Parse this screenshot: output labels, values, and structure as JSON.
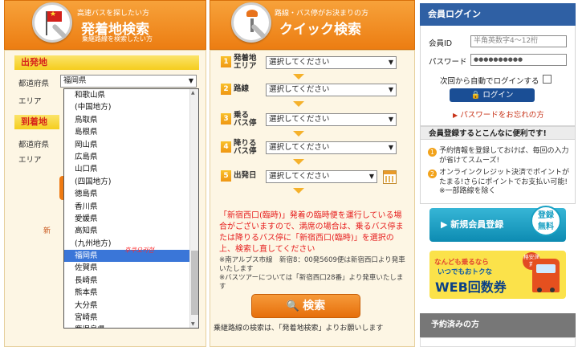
{
  "departure_panel": {
    "header_small": "高速バスを探したい方",
    "header_title": "発着地検索",
    "header_sub": "乗継路線を検索したい方",
    "departure_section": "出発地",
    "arrival_section": "到着地",
    "prefecture_label": "都道府県",
    "area_label": "エリア",
    "prefecture_selected": "福岡県",
    "prefecture_options": [
      "和歌山県",
      "(中国地方)",
      "鳥取県",
      "島根県",
      "岡山県",
      "広島県",
      "山口県",
      "(四国地方)",
      "徳島県",
      "香川県",
      "愛媛県",
      "高知県",
      "(九州地方)",
      "福岡県",
      "佐賀県",
      "長崎県",
      "熊本県",
      "大分県",
      "宮崎県",
      "鹿児島県"
    ],
    "selected_index": 13,
    "annotation_text": "후쿠오카현",
    "link_fragment": "新"
  },
  "quick_panel": {
    "header_small": "路線・バス停がお決まりの方",
    "header_title": "クイック検索",
    "steps": [
      {
        "num": "1",
        "label_line1": "発着地",
        "label_line2": "エリア",
        "select": "選択してください"
      },
      {
        "num": "2",
        "label_line1": "路線",
        "label_line2": "",
        "select": "選択してください"
      },
      {
        "num": "3",
        "label_line1": "乗る",
        "label_line2": "バス停",
        "select": "選択してください"
      },
      {
        "num": "4",
        "label_line1": "降りる",
        "label_line2": "バス停",
        "select": "選択してください"
      },
      {
        "num": "5",
        "label_line1": "出発日",
        "label_line2": "",
        "select": "選択してください"
      }
    ],
    "notice": "「新宿西口(臨時)」発着の臨時便を運行している場合がございますので、満席の場合は、乗るバス停または降りるバス停に「新宿西口(臨時)」を選択の上、検索し直してください",
    "note1": "※南アルプス市線　新宿8：00発5609便は新宿西口より発車いたします",
    "note2": "※バスツアーについては「新宿西口28番」より発車いたします",
    "search_button": "検索",
    "bottom_note": "乗継路線の検索は、「発着地検索」よりお願いします"
  },
  "login_panel": {
    "header": "会員ログイン",
    "id_label": "会員ID",
    "id_placeholder": "半角英数字4〜12桁",
    "password_label": "パスワード",
    "password_value": "●●●●●●●●●●",
    "remember_label": "次回から自動でログインする",
    "login_button": "ログイン",
    "forgot_link": "パスワードをお忘れの方"
  },
  "benefits": {
    "header": "会員登録するとこんなに便利です!",
    "items": [
      {
        "num": "1",
        "text": "予約情報を登録しておけば、毎回の入力が省けてスムーズ!"
      },
      {
        "num": "2",
        "text": "オンラインクレジット決済でポイントがたまる!さらにポイントでお支払い可能! ※一部路線を除く"
      }
    ]
  },
  "signup": {
    "button": "新規会員登録",
    "badge_line1": "登録",
    "badge_line2": "無料"
  },
  "web_banner": {
    "line1": "なんども乗るなら",
    "line2": "いつでもおトクな",
    "line3": "WEB回数券",
    "tag": "格安運賃"
  },
  "reserved": {
    "header": "予約済みの方"
  }
}
